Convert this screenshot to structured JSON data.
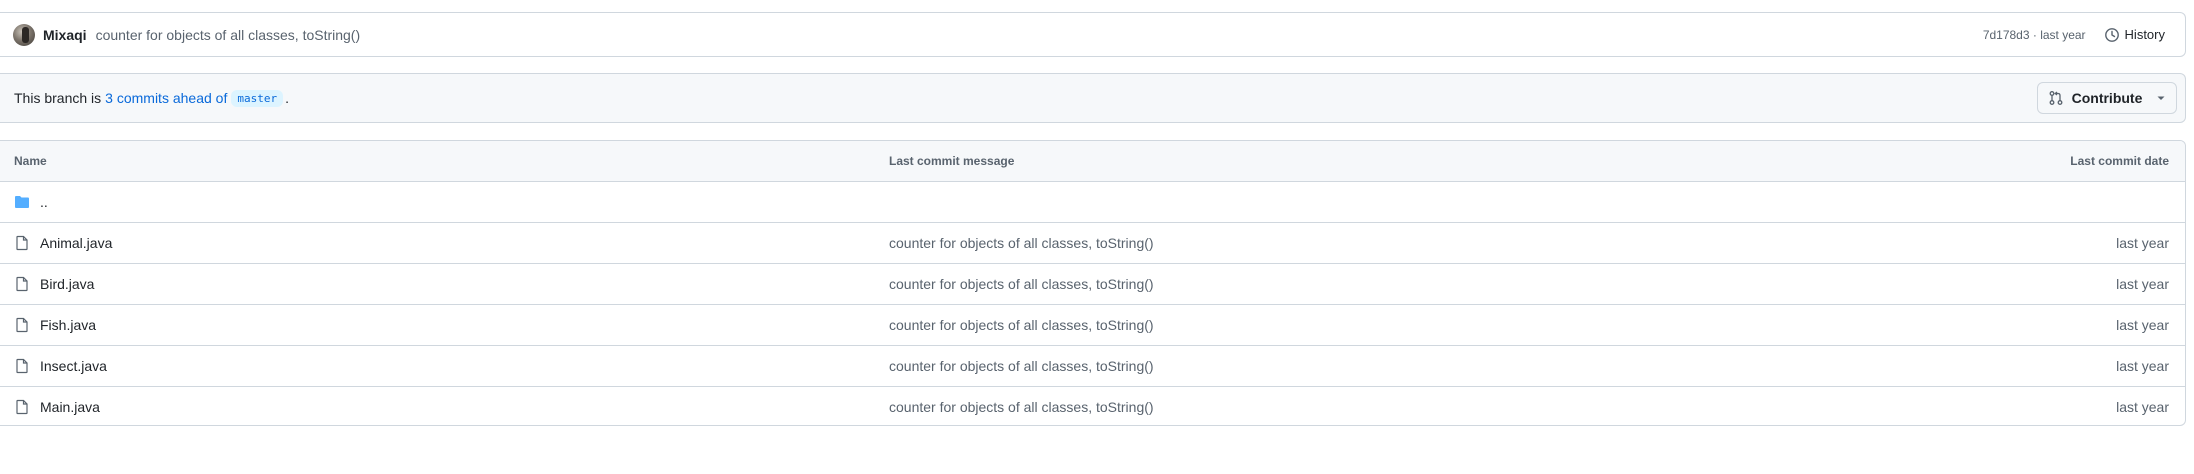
{
  "commit_bar": {
    "author": "Mixaqi",
    "message": "counter for objects of all classes, toString()",
    "sha_time": "7d178d3 · last year",
    "history_label": "History"
  },
  "branch_bar": {
    "prefix": "This branch is",
    "link_text": "3 commits ahead of",
    "branch": "master",
    "suffix": ".",
    "contribute_label": "Contribute"
  },
  "table": {
    "headers": {
      "name": "Name",
      "message": "Last commit message",
      "date": "Last commit date"
    },
    "parent_dir": "..",
    "rows": [
      {
        "name": "Animal.java",
        "message": "counter for objects of all classes, toString()",
        "date": "last year"
      },
      {
        "name": "Bird.java",
        "message": "counter for objects of all classes, toString()",
        "date": "last year"
      },
      {
        "name": "Fish.java",
        "message": "counter for objects of all classes, toString()",
        "date": "last year"
      },
      {
        "name": "Insect.java",
        "message": "counter for objects of all classes, toString()",
        "date": "last year"
      },
      {
        "name": "Main.java",
        "message": "counter for objects of all classes, toString()",
        "date": "last year"
      }
    ]
  },
  "colors": {
    "link": "#0969da",
    "folder": "#54aeff",
    "muted": "#59636e"
  },
  "icons": {
    "folder": "folder-icon",
    "file": "file-icon",
    "history": "clock-icon",
    "contribute": "pull-request-icon",
    "caret": "triangle-down-icon"
  }
}
